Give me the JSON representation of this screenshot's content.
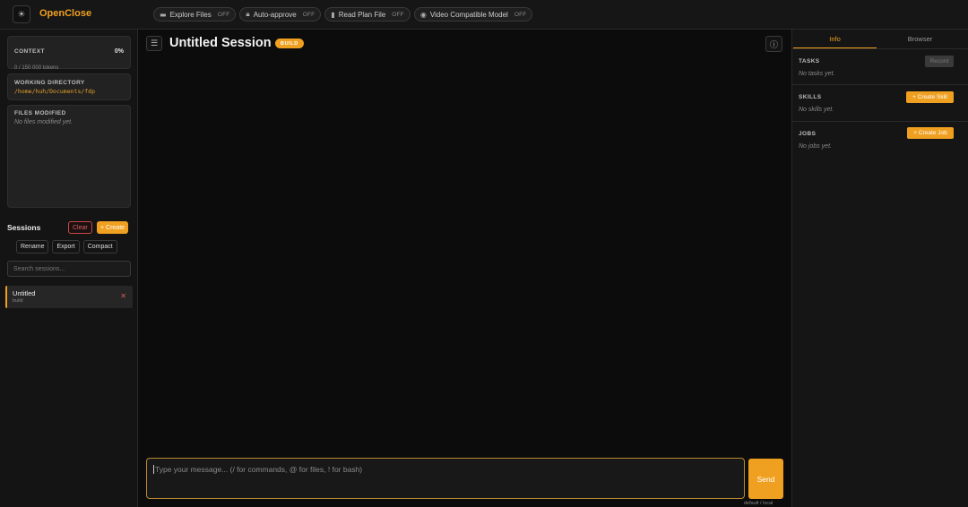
{
  "app": {
    "title": "OpenClose",
    "theme_icon": "sun-icon"
  },
  "colors": {
    "accent": "#f0a020",
    "danger": "#e05c5c",
    "background": "#0c0c0c"
  },
  "toolbar": {
    "toggles": [
      {
        "label": "Explore Files",
        "state": "OFF",
        "icon": "folder-icon"
      },
      {
        "label": "Auto-approve",
        "state": "OFF",
        "icon": "lock-icon"
      },
      {
        "label": "Read Plan File",
        "state": "OFF",
        "icon": "document-icon"
      },
      {
        "label": "Video Compatible Model",
        "state": "OFF",
        "icon": "eye-icon"
      }
    ]
  },
  "sidebar": {
    "context": {
      "title": "CONTEXT",
      "percent": "0%",
      "tokens": "0 / 150 000 tokens"
    },
    "working_directory": {
      "title": "WORKING DIRECTORY",
      "path": "/home/huh/Documents/fdp"
    },
    "files_modified": {
      "title": "FILES MODIFIED",
      "empty": "No files modified yet."
    },
    "sessions": {
      "title": "Sessions",
      "clear_label": "Clear",
      "create_label": "+ Create",
      "actions": [
        "Rename",
        "Export",
        "Compact"
      ],
      "search_placeholder": "Search sessions...",
      "items": [
        {
          "name": "Untitled",
          "mode": "build"
        }
      ]
    }
  },
  "main": {
    "title": "Untitled Session",
    "badge": "BUILD",
    "input_placeholder": "Type your message... (/ for commands, @ for files, ! for bash)",
    "send_label": "Send",
    "model_label": "default / local"
  },
  "right_panel": {
    "tabs": [
      "Info",
      "Browser"
    ],
    "active_tab": "Info",
    "tasks": {
      "title": "TASKS",
      "button": "Record",
      "empty": "No tasks yet."
    },
    "skills": {
      "title": "SKILLS",
      "button": "+ Create Skill",
      "empty": "No skills yet."
    },
    "jobs": {
      "title": "JOBS",
      "button": "+ Create Job",
      "empty": "No jobs yet."
    }
  }
}
